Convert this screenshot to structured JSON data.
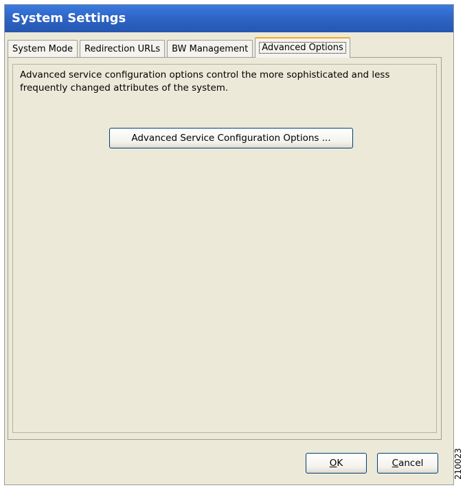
{
  "window": {
    "title": "System Settings"
  },
  "tabs": [
    {
      "label": "System Mode",
      "active": false
    },
    {
      "label": "Redirection URLs",
      "active": false
    },
    {
      "label": "BW Management",
      "active": false
    },
    {
      "label": "Advanced Options",
      "active": true
    }
  ],
  "panel": {
    "description": "Advanced service configuration options control the more sophisticated and less frequently changed attributes of the system.",
    "advanced_button_label": "Advanced Service Configuration Options ..."
  },
  "footer": {
    "ok": {
      "mnemonic": "O",
      "rest": "K"
    },
    "cancel": {
      "mnemonic": "C",
      "rest": "ancel"
    }
  },
  "figure_number": "210023",
  "colors": {
    "titlebar": "#2f66c7",
    "window_bg": "#ece9d8",
    "active_tab_highlight": "#f5a623",
    "button_border": "#003c74"
  }
}
